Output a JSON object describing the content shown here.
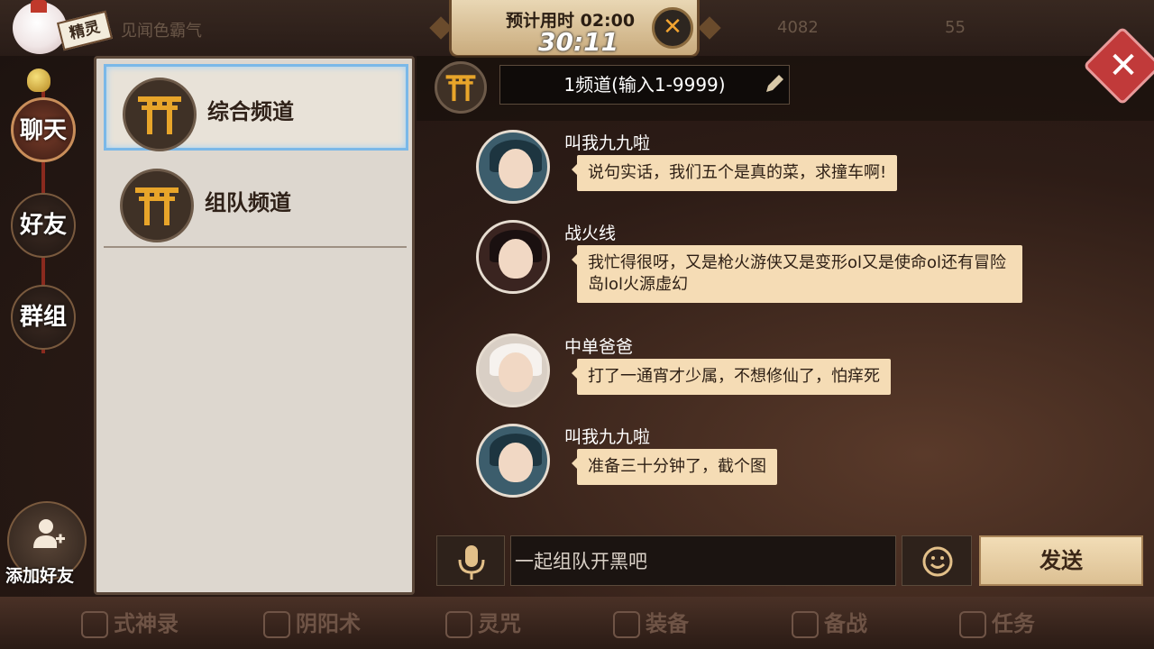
{
  "top": {
    "sprite_tag": "精灵",
    "faded_title": "见闻色霸气",
    "faded_num1": "4082",
    "faded_num2": "55"
  },
  "timer": {
    "estimate": "预计用时 02:00",
    "elapsed": "30:11",
    "close": "✕"
  },
  "nav": {
    "chat": "聊天",
    "friends": "好友",
    "groups": "群组",
    "add_friend": "添加好友"
  },
  "channels": [
    {
      "label": "综合频道"
    },
    {
      "label": "组队频道"
    }
  ],
  "chat": {
    "channel_input": "1频道(输入1-9999)",
    "messages": [
      {
        "sender": "叫我九九啦",
        "text": "说句实话，我们五个是真的菜，求撞车啊!"
      },
      {
        "sender": "战火线",
        "text": "我忙得很呀，又是枪火游侠又是变形ol又是使命ol还有冒险岛lol火源虚幻"
      },
      {
        "sender": "中单爸爸",
        "text": "打了一通宵才少属，不想修仙了，怕痒死"
      },
      {
        "sender": "叫我九九啦",
        "text": "准备三十分钟了，截个图"
      }
    ],
    "input_placeholder": "一起组队开黑吧",
    "send": "发送"
  },
  "bottom": {
    "items": [
      "式神录",
      "阴阳术",
      "灵咒",
      "装备",
      "备战",
      "任务"
    ]
  },
  "colors": {
    "bubble": "#f5dcb5",
    "torii": "#e8a52a",
    "close_red": "#c13a3a"
  }
}
